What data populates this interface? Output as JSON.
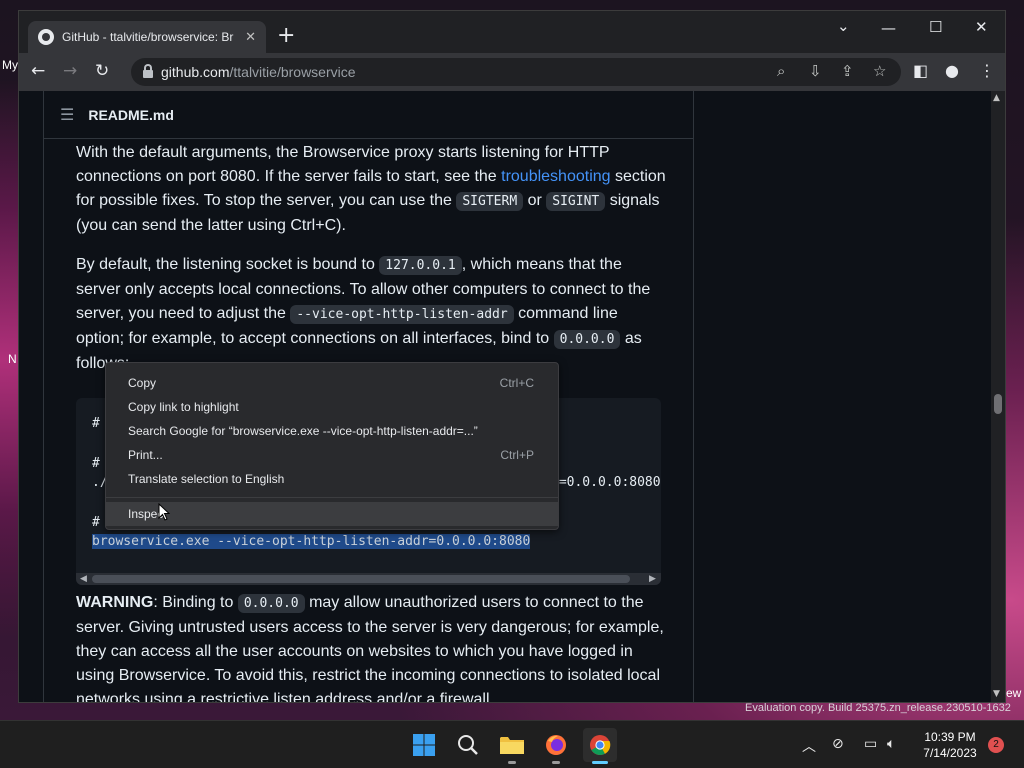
{
  "desktop": {
    "left_label": "My",
    "left_label2": "N",
    "right_label": "ew",
    "watermark": "Evaluation copy. Build 25375.zn_release.230510-1632"
  },
  "browser": {
    "tab": {
      "title": "GitHub - ttalvitie/browservice: Br",
      "favicon": "github-icon"
    },
    "new_tab": "+",
    "window_controls": {
      "dropdown": "⌄",
      "minimize": "—",
      "maximize": "☐",
      "close": "✕"
    },
    "url": {
      "host": "github.com",
      "path": "/ttalvitie/browservice"
    }
  },
  "readme": {
    "title": "README.md",
    "p1": {
      "t1": "With the default arguments, the Browservice proxy starts listening for HTTP connections on port 8080. If the server fails to start, see the ",
      "link": "troubleshooting",
      "t2": " section for possible fixes. To stop the server, you can use the ",
      "code1": "SIGTERM",
      "t3": " or ",
      "code2": "SIGINT",
      "t4": " signals (you can send the latter using Ctrl+C)."
    },
    "p2": {
      "t1": "By default, the listening socket is bound to ",
      "code1": "127.0.0.1",
      "t2": ", which means that the server only accepts local connections. To allow other computers to connect to the server, you need to adjust the ",
      "code2": "--vice-opt-http-listen-addr",
      "t3": " command line option; for example, to accept connections on all interfaces, bind to ",
      "code3": "0.0.0.0",
      "t4": " as follows:"
    },
    "code": {
      "line1": "#",
      "line2": "#",
      "line3": "./",
      "line3_tail": "r=0.0.0.0:8080",
      "line4": "#",
      "line5_selected": "browservice.exe --vice-opt-http-listen-addr=0.0.0.0:8080"
    },
    "p3": {
      "bold": "WARNING",
      "t1": ": Binding to ",
      "code1": "0.0.0.0",
      "t2": " may allow unauthorized users to connect to the server. Giving untrusted users access to the server is very dangerous; for example, they can access all the user accounts on websites to which you have logged in using Browservice. To avoid this, restrict the incoming connections to isolated local networks using a restrictive listen address and/or a firewall."
    }
  },
  "context_menu": {
    "items": [
      {
        "label": "Copy",
        "shortcut": "Ctrl+C"
      },
      {
        "label": "Copy link to highlight",
        "shortcut": ""
      },
      {
        "label": "Search Google for “browservice.exe --vice-opt-http-listen-addr=...”",
        "shortcut": ""
      },
      {
        "label": "Print...",
        "shortcut": "Ctrl+P"
      },
      {
        "label": "Translate selection to English",
        "shortcut": ""
      },
      {
        "label": "Inspect",
        "shortcut": ""
      }
    ]
  },
  "taskbar": {
    "time": "10:39 PM",
    "date": "7/14/2023",
    "notification_count": "2"
  },
  "colors": {
    "accent": "#4493f8",
    "page_bg": "#0d1117",
    "selection": "#1f4a8a"
  }
}
